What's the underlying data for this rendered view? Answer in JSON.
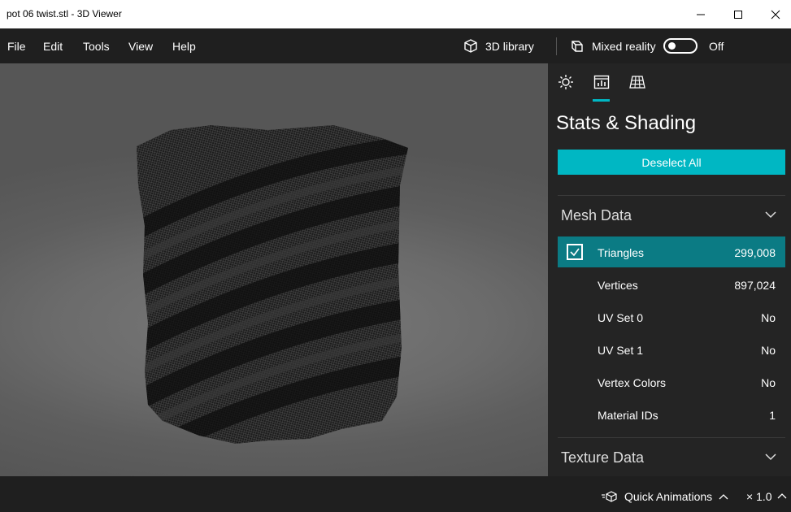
{
  "window": {
    "title": "pot 06 twist.stl - 3D Viewer"
  },
  "menu": {
    "items": [
      "File",
      "Edit",
      "Tools",
      "View",
      "Help"
    ]
  },
  "header": {
    "library_label": "3D library",
    "mixed_reality_label": "Mixed reality",
    "toggle_state": "Off"
  },
  "panel": {
    "title": "Stats & Shading",
    "deselect_label": "Deselect All",
    "mesh_section": "Mesh Data",
    "mesh_rows": [
      {
        "label": "Triangles",
        "value": "299,008"
      },
      {
        "label": "Vertices",
        "value": "897,024"
      },
      {
        "label": "UV Set 0",
        "value": "No"
      },
      {
        "label": "UV Set 1",
        "value": "No"
      },
      {
        "label": "Vertex Colors",
        "value": "No"
      },
      {
        "label": "Material IDs",
        "value": "1"
      }
    ],
    "texture_section": "Texture Data"
  },
  "status": {
    "animations_label": "Quick Animations",
    "speed": "× 1.0"
  },
  "colors": {
    "accent": "#00b7c3",
    "selected_row": "#0b7b84"
  }
}
